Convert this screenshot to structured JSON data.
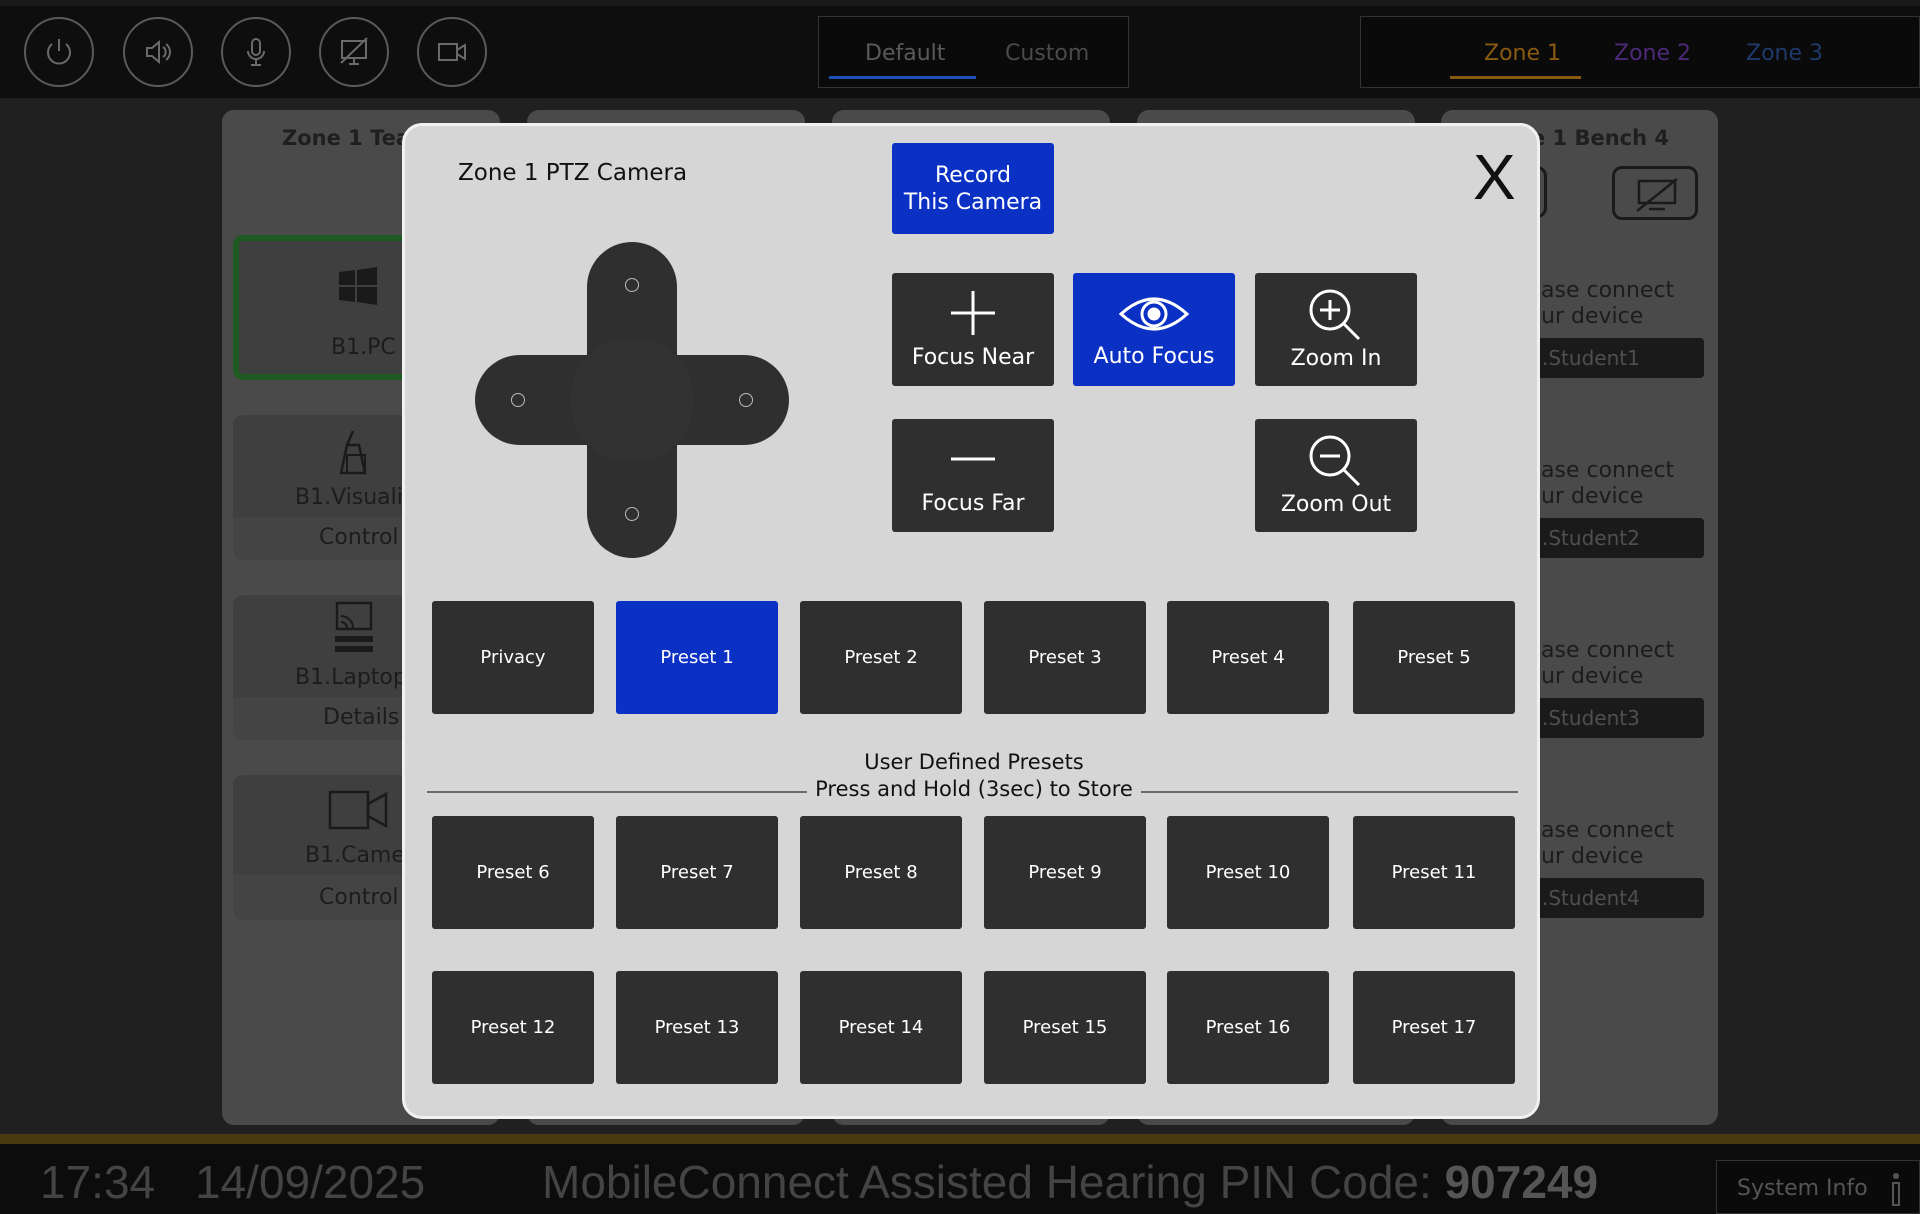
{
  "topbar": {
    "icons": [
      "power-icon",
      "speaker-icon",
      "microphone-icon",
      "display-off-icon",
      "camera-icon"
    ],
    "view_tabs": [
      "Default",
      "Custom"
    ],
    "zone_tabs": [
      "Zone 1",
      "Zone 2",
      "Zone 3"
    ],
    "colors": {
      "default_underline": "#1e4fb5",
      "zone1": "#8a5a12",
      "zone2": "#4d2a78",
      "zone3": "#1e3a6b"
    }
  },
  "background": {
    "left_column_title": "Zone 1 Teac",
    "right_column_title": "e 1 Bench 4",
    "sources": [
      {
        "label": "B1.PC",
        "sub": ""
      },
      {
        "label": "B1.Visualis",
        "sub": "Control"
      },
      {
        "label": "B1.Laptop",
        "sub": "Details"
      },
      {
        "label": "B1.Camer",
        "sub": "Control"
      }
    ],
    "students": [
      {
        "line1": "ase connect",
        "line2": "ur device",
        "bar": ".Student1"
      },
      {
        "line1": "ase connect",
        "line2": "ur device",
        "bar": ".Student2"
      },
      {
        "line1": "ase connect",
        "line2": "ur device",
        "bar": ".Student3"
      },
      {
        "line1": "ase connect",
        "line2": "ur device",
        "bar": ".Student4"
      }
    ]
  },
  "modal": {
    "title": "Zone 1 PTZ Camera",
    "record_line1": "Record",
    "record_line2": "This Camera",
    "close_label": "X",
    "focus_near": "Focus Near",
    "auto_focus": "Auto Focus",
    "zoom_in": "Zoom In",
    "focus_far": "Focus Far",
    "zoom_out": "Zoom Out",
    "top_presets": [
      "Privacy",
      "Preset 1",
      "Preset 2",
      "Preset 3",
      "Preset 4",
      "Preset 5"
    ],
    "active_preset": "Preset 1",
    "user_presets_line1": "User Defined Presets",
    "user_presets_line2": "Press and Hold (3sec) to Store",
    "user_presets_row1": [
      "Preset 6",
      "Preset 7",
      "Preset 8",
      "Preset 9",
      "Preset 10",
      "Preset 11"
    ],
    "user_presets_row2": [
      "Preset 12",
      "Preset 13",
      "Preset 14",
      "Preset 15",
      "Preset 16",
      "Preset 17"
    ],
    "accent_blue": "#0b31c4"
  },
  "bottombar": {
    "time": "17:34",
    "date": "14/09/2025",
    "pin_label": "MobileConnect Assisted Hearing PIN Code: ",
    "pin_code": "907249",
    "system_info": "System Info"
  }
}
